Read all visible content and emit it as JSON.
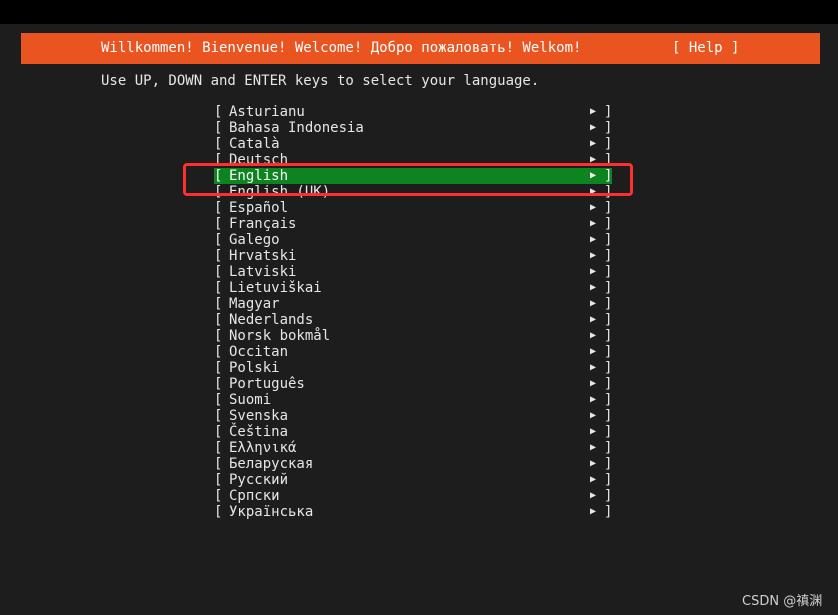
{
  "header": {
    "title": "Willkommen! Bienvenue! Welcome! Добро пожаловать! Welkom!",
    "help_label": "[ Help ]"
  },
  "instruction": "Use UP, DOWN and ENTER keys to select your language.",
  "list": {
    "left_bracket": "[",
    "right_bracket": "]",
    "arrow": "▶",
    "items": [
      {
        "label": "Asturianu"
      },
      {
        "label": "Bahasa Indonesia"
      },
      {
        "label": "Català"
      },
      {
        "label": "Deutsch"
      },
      {
        "label": "English",
        "selected": true
      },
      {
        "label": "English (UK)"
      },
      {
        "label": "Español"
      },
      {
        "label": "Français"
      },
      {
        "label": "Galego"
      },
      {
        "label": "Hrvatski"
      },
      {
        "label": "Latviski"
      },
      {
        "label": "Lietuviškai"
      },
      {
        "label": "Magyar"
      },
      {
        "label": "Nederlands"
      },
      {
        "label": "Norsk bokmål"
      },
      {
        "label": "Occitan"
      },
      {
        "label": "Polski"
      },
      {
        "label": "Português"
      },
      {
        "label": "Suomi"
      },
      {
        "label": "Svenska"
      },
      {
        "label": "Čeština"
      },
      {
        "label": "Ελληνικά"
      },
      {
        "label": "Беларуская"
      },
      {
        "label": "Русский"
      },
      {
        "label": "Српски"
      },
      {
        "label": "Українська"
      }
    ]
  },
  "watermark": "CSDN @禛渊",
  "colors": {
    "header_bg": "#e95420",
    "selected_bg": "#0e8420",
    "highlight_border": "#ff2f2f",
    "screen_bg": "#1d1d1d"
  }
}
